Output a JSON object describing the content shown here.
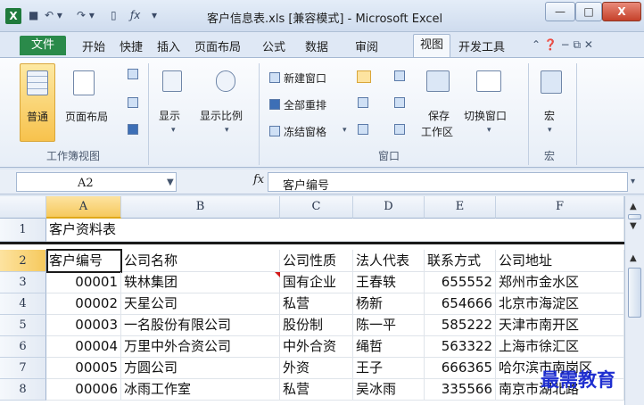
{
  "window": {
    "title": "客户信息表.xls  [兼容模式] - Microsoft Excel",
    "logo": "X",
    "minimize": "—",
    "maximize": "□",
    "close": "X"
  },
  "quick_access": {
    "save": "■",
    "undo": "↶ ▾",
    "redo": "↷ ▾",
    "new": "▯",
    "fx": "ƒx",
    "customize": "▾"
  },
  "tabs": {
    "file": "文件",
    "items": [
      "开始",
      "快捷",
      "插入",
      "页面布局",
      "公式",
      "数据",
      "审阅",
      "视图",
      "开发工具"
    ],
    "active": "视图",
    "right_icons": "⌃ ❓ − ⧉ ✕"
  },
  "ribbon": {
    "groups": {
      "workbook_views": "工作簿视图",
      "window": "窗口",
      "macro": "宏"
    },
    "buttons": {
      "normal": "普通",
      "page_layout": "页面布局",
      "show": "显示",
      "zoom": "显示比例",
      "new_window": "新建窗口",
      "arrange_all": "全部重排",
      "freeze_panes": "冻结窗格",
      "save_workspace_1": "保存",
      "save_workspace_2": "工作区",
      "switch_windows": "切换窗口",
      "macros": "宏"
    }
  },
  "formula_bar": {
    "name_box": "A2",
    "fx": "fx",
    "value": "客户编号"
  },
  "grid": {
    "columns": [
      "A",
      "B",
      "C",
      "D",
      "E",
      "F"
    ],
    "frozen_row": {
      "num": "1",
      "a": "客户资料表"
    },
    "header_row": {
      "num": "2",
      "cells": [
        "客户编号",
        "公司名称",
        "公司性质",
        "法人代表",
        "联系方式",
        "公司地址"
      ]
    },
    "rows": [
      {
        "num": "3",
        "cells": [
          "00001",
          "轶林集团",
          "国有企业",
          "王春轶",
          "655552",
          "郑州市金水区"
        ]
      },
      {
        "num": "4",
        "cells": [
          "00002",
          "天星公司",
          "私营",
          "杨新",
          "654666",
          "北京市海淀区"
        ]
      },
      {
        "num": "5",
        "cells": [
          "00003",
          "一名股份有限公司",
          "股份制",
          "陈一平",
          "585222",
          "天津市南开区"
        ]
      },
      {
        "num": "6",
        "cells": [
          "00004",
          "万里中外合资公司",
          "中外合资",
          "绳哲",
          "563322",
          "上海市徐汇区"
        ]
      },
      {
        "num": "7",
        "cells": [
          "00005",
          "方圆公司",
          "外资",
          "王子",
          "666365",
          "哈尔滨市南岗区"
        ]
      },
      {
        "num": "8",
        "cells": [
          "00006",
          "冰雨工作室",
          "私营",
          "吴冰雨",
          "335566",
          "南京市湖北路"
        ]
      }
    ]
  },
  "watermark": "最需教育"
}
